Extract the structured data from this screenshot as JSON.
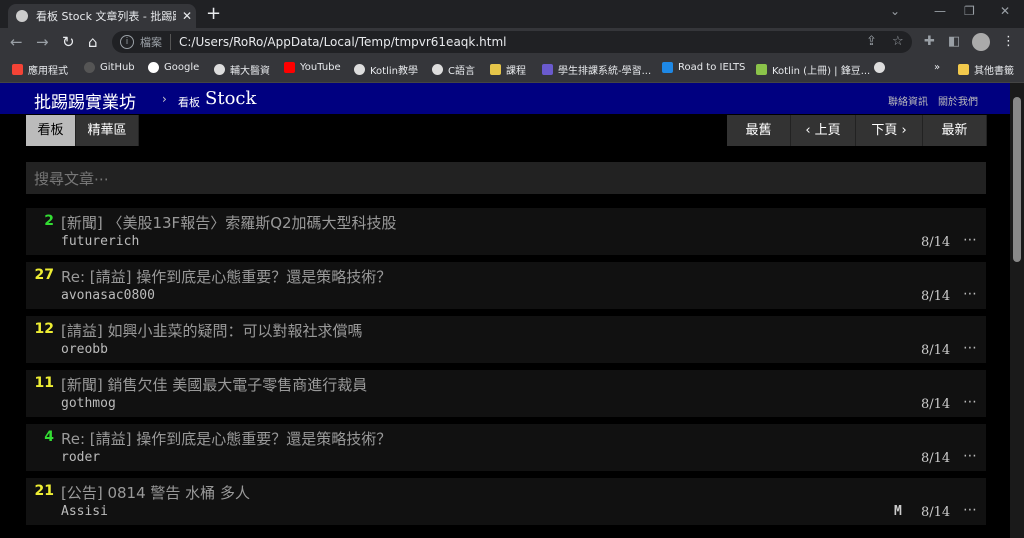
{
  "browser": {
    "tab_title": "看板 Stock 文章列表 - 批踢踢實業坊",
    "tab_close": "✕",
    "new_tab": "+",
    "scheme": "檔案",
    "url": "C:/Users/RoRo/AppData/Local/Temp/tmpvr61eaqk.html",
    "bookmarks": [
      {
        "label": "應用程式",
        "color": "#f44336"
      },
      {
        "label": "GitHub",
        "color": "#444444"
      },
      {
        "label": "Google",
        "color": "#ffffff"
      },
      {
        "label": "輔大醫資",
        "color": "#dddddd"
      },
      {
        "label": "YouTube",
        "color": "#ff0000"
      },
      {
        "label": "Kotlin教學",
        "color": "#dddddd"
      },
      {
        "label": "C語言",
        "color": "#dddddd"
      },
      {
        "label": "課程",
        "color": "#e6c64a"
      },
      {
        "label": "學生排課系統-學習...",
        "color": "#6a5acd"
      },
      {
        "label": "Road to IELTS",
        "color": "#1e88e5"
      },
      {
        "label": "Kotlin (上冊) | 鋒豆...",
        "color": "#8bc34a"
      },
      {
        "label": "",
        "color": "#dddddd"
      }
    ],
    "more_bookmarks": "»",
    "other_bookmarks": "其他書籤"
  },
  "header": {
    "brand": "批踢踢實業坊",
    "separator": "›",
    "board_label": "看板",
    "board_name": "Stock",
    "links": [
      "聯絡資訊",
      "關於我們"
    ]
  },
  "nav": {
    "left": [
      "看板",
      "精華區"
    ],
    "right": [
      "最舊",
      "‹ 上頁",
      "下頁 ›",
      "最新"
    ]
  },
  "search": {
    "placeholder": "搜尋文章⋯"
  },
  "posts": [
    {
      "nrec": "2",
      "nrec_color": "#33dd33",
      "title": "[新聞] 〈美股13F報告〉索羅斯Q2加碼大型科技股",
      "author": "futurerich",
      "mark": "",
      "date": "8/14"
    },
    {
      "nrec": "27",
      "nrec_color": "#eeee33",
      "title": "Re: [請益] 操作到底是心態重要？還是策略技術？",
      "author": "avonasac0800",
      "mark": "",
      "date": "8/14"
    },
    {
      "nrec": "12",
      "nrec_color": "#eeee33",
      "title": "[請益] 如興小韭菜的疑問：可以對報社求償嗎",
      "author": "oreobb",
      "mark": "",
      "date": "8/14"
    },
    {
      "nrec": "11",
      "nrec_color": "#eeee33",
      "title": "[新聞] 銷售欠佳 美國最大電子零售商進行裁員",
      "author": "gothmog",
      "mark": "",
      "date": "8/14"
    },
    {
      "nrec": "4",
      "nrec_color": "#33dd33",
      "title": "Re: [請益] 操作到底是心態重要？還是策略技術？",
      "author": "roder",
      "mark": "",
      "date": "8/14"
    },
    {
      "nrec": "21",
      "nrec_color": "#eeee33",
      "title": "[公告] 0814 警告 水桶 多人",
      "author": "Assisi",
      "mark": "M",
      "date": "8/14"
    }
  ],
  "more_label": "⋯"
}
